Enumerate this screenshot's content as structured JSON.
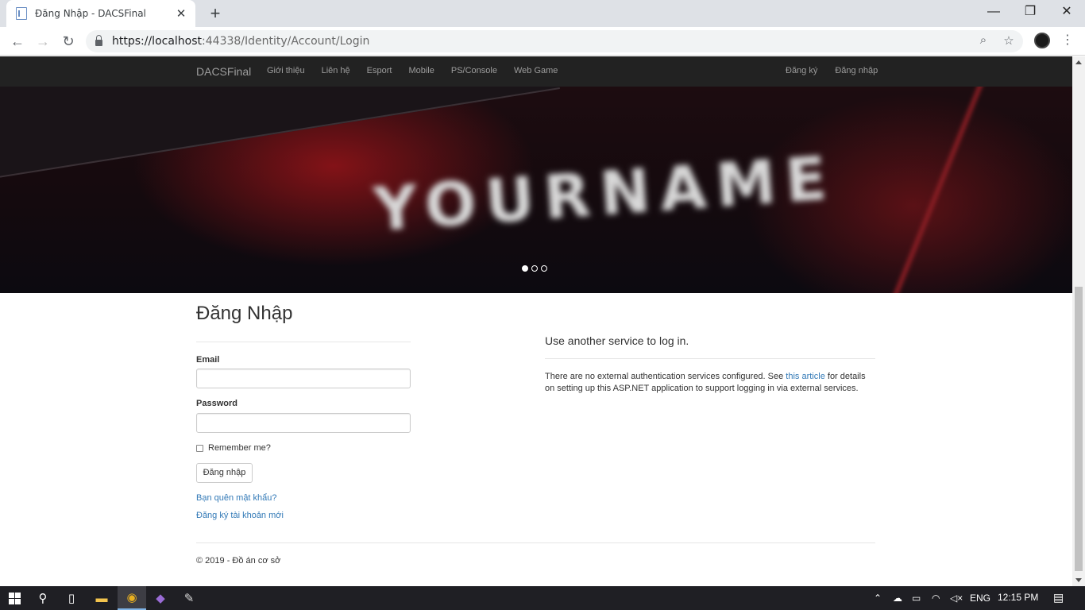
{
  "browser": {
    "tab_title": "Đăng Nhập - DACSFinal",
    "new_tab": "+",
    "url_host": "https://localhost",
    "url_rest": ":44338/Identity/Account/Login"
  },
  "navbar": {
    "brand": "DACSFinal",
    "links": [
      "Giới thiệu",
      "Liên hệ",
      "Esport",
      "Mobile",
      "PS/Console",
      "Web Game"
    ],
    "right_links": [
      "Đăng ký",
      "Đăng nhập"
    ]
  },
  "banner": {
    "text": "YOURNAME",
    "slides_total": 3,
    "active_slide": 1
  },
  "login": {
    "title": "Đăng Nhập",
    "email_label": "Email",
    "email_value": "",
    "password_label": "Password",
    "password_value": "",
    "remember_label": "Remember me?",
    "submit_label": "Đăng nhập",
    "forgot_link": "Bạn quên mật khẩu?",
    "register_link": "Đăng ký tài khoản mới"
  },
  "external": {
    "title": "Use another service to log in.",
    "text_before": "There are no external authentication services configured. See ",
    "link_text": "this article",
    "text_after": " for details on setting up this ASP.NET application to support logging in via external services."
  },
  "footer": {
    "text": "© 2019 - Đồ án cơ sở"
  },
  "taskbar": {
    "language": "ENG",
    "time": "12:15 PM"
  }
}
